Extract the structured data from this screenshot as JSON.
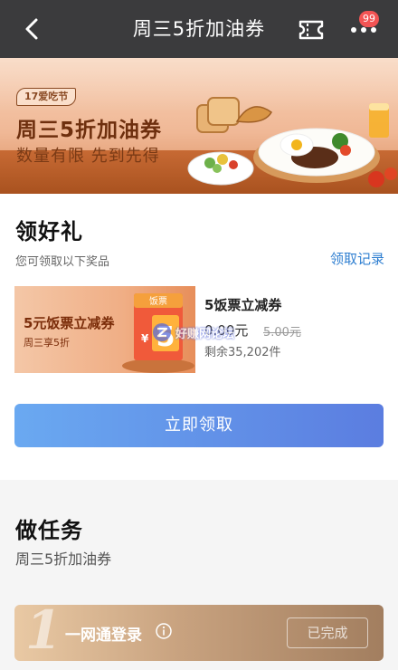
{
  "nav": {
    "title": "周三5折加油券",
    "badge": "99",
    "icons": {
      "back": "chevron-left-icon",
      "ticket": "ticket-icon",
      "more": "more-dots-icon"
    }
  },
  "banner": {
    "tag": "17爱吃节",
    "title": "周三5折加油券",
    "subtitle": "数量有限 先到先得"
  },
  "gift": {
    "heading": "领好礼",
    "description": "您可领取以下奖品",
    "record_link": "领取记录",
    "coupon": {
      "card_title": "5元饭票立减券",
      "card_subtitle": "周三享5折",
      "card_ribbon": "饭票",
      "card_currency": "¥",
      "card_amount": "5",
      "name": "5饭票立减券",
      "price": "0.00元",
      "original_price": "5.00元",
      "remaining": "剩余35,202件"
    },
    "watermark": "好赚网论坛",
    "claim_button": "立即领取"
  },
  "task": {
    "heading": "做任务",
    "subtitle": "周三5折加油券",
    "items": [
      {
        "number": "1",
        "label": "一网通登录",
        "status": "已完成"
      }
    ]
  },
  "colors": {
    "nav_bg": "#3b3b3d",
    "link": "#2f7fd1",
    "button_start": "#6aa9f1",
    "button_end": "#5b7de0",
    "badge": "#f25454"
  }
}
